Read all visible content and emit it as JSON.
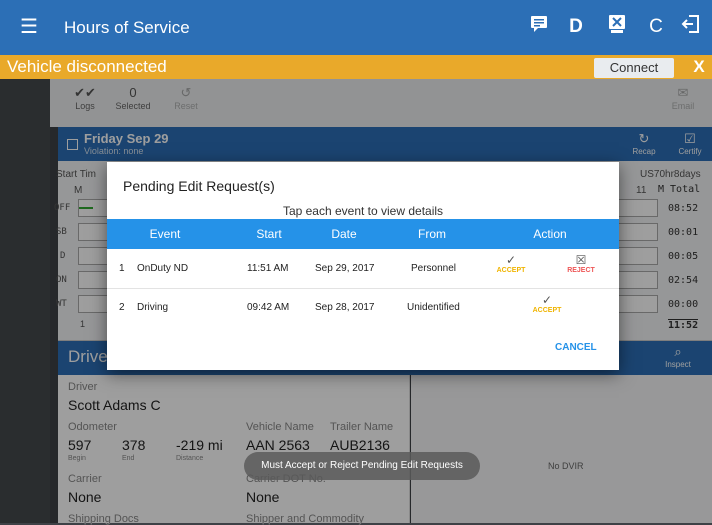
{
  "appbar": {
    "title": "Hours of Service",
    "icons": [
      "menu-icon",
      "message-icon",
      "d-icon",
      "eld-icon",
      "refresh-icon",
      "logout-icon"
    ],
    "d_label": "D",
    "refresh_glyph": "C"
  },
  "connection": {
    "status": "Vehicle disconnected",
    "connect_label": "Connect",
    "close_label": "X"
  },
  "toolbar": {
    "logs_label": "Logs",
    "selected_count": "0",
    "selected_label": "Selected",
    "reset_label": "Reset",
    "email_label": "Email"
  },
  "day": {
    "date": "Friday Sep 29",
    "violation": "Violation: none",
    "recap_label": "Recap",
    "certify_label": "Certify",
    "ruleset": "US70hr8days",
    "start_time_label": "Start Tim",
    "hour_m": "M",
    "hour_11": "11",
    "total_label": "M Total",
    "hour_1": "1"
  },
  "grid": {
    "statuses": [
      "OFF",
      "SB",
      "D",
      "ON",
      "WT"
    ],
    "totals": [
      "08:52",
      "00:01",
      "00:05",
      "02:54",
      "00:00"
    ],
    "grand_total": "11:52"
  },
  "driver_section": {
    "title": "Drive",
    "inspect_label": "Inspect",
    "driver_key": "Driver",
    "driver_name": "Scott Adams C",
    "odometer_key": "Odometer",
    "odo_begin": "597",
    "odo_end": "378",
    "odo_distance": "-219 mi",
    "begin_label": "Begin",
    "end_label": "End",
    "distance_label": "Distance",
    "vehicle_key": "Vehicle Name",
    "vehicle_name": "AAN 2563",
    "trailer_key": "Trailer Name",
    "trailer_name": "AUB2136",
    "carrier_key": "Carrier",
    "carrier_value": "None",
    "carrier_dot_key": "Carrier DOT No.",
    "carrier_dot_value": "None",
    "shipping_key": "Shipping Docs",
    "shipper_key": "Shipper and Commodity",
    "no_dvir": "No DVIR"
  },
  "dialog": {
    "title": "Pending Edit Request(s)",
    "subtitle": "Tap each event to view details",
    "columns": {
      "event": "Event",
      "start": "Start",
      "date": "Date",
      "from": "From",
      "action": "Action"
    },
    "rows": [
      {
        "num": "1",
        "event": "OnDuty ND",
        "start": "11:51 AM",
        "date": "Sep 29, 2017",
        "from": "Personnel",
        "accept": "ACCEPT",
        "reject": "REJECT"
      },
      {
        "num": "2",
        "event": "Driving",
        "start": "09:42 AM",
        "date": "Sep 28, 2017",
        "from": "Unidentified",
        "accept": "ACCEPT"
      }
    ],
    "cancel_label": "CANCEL"
  },
  "toast": "Must Accept or Reject Pending Edit Requests",
  "colors": {
    "primary": "#2c6fb6",
    "warning": "#e9a92a",
    "header": "#2592e8",
    "accept": "#f0b400",
    "reject": "#e55555"
  }
}
